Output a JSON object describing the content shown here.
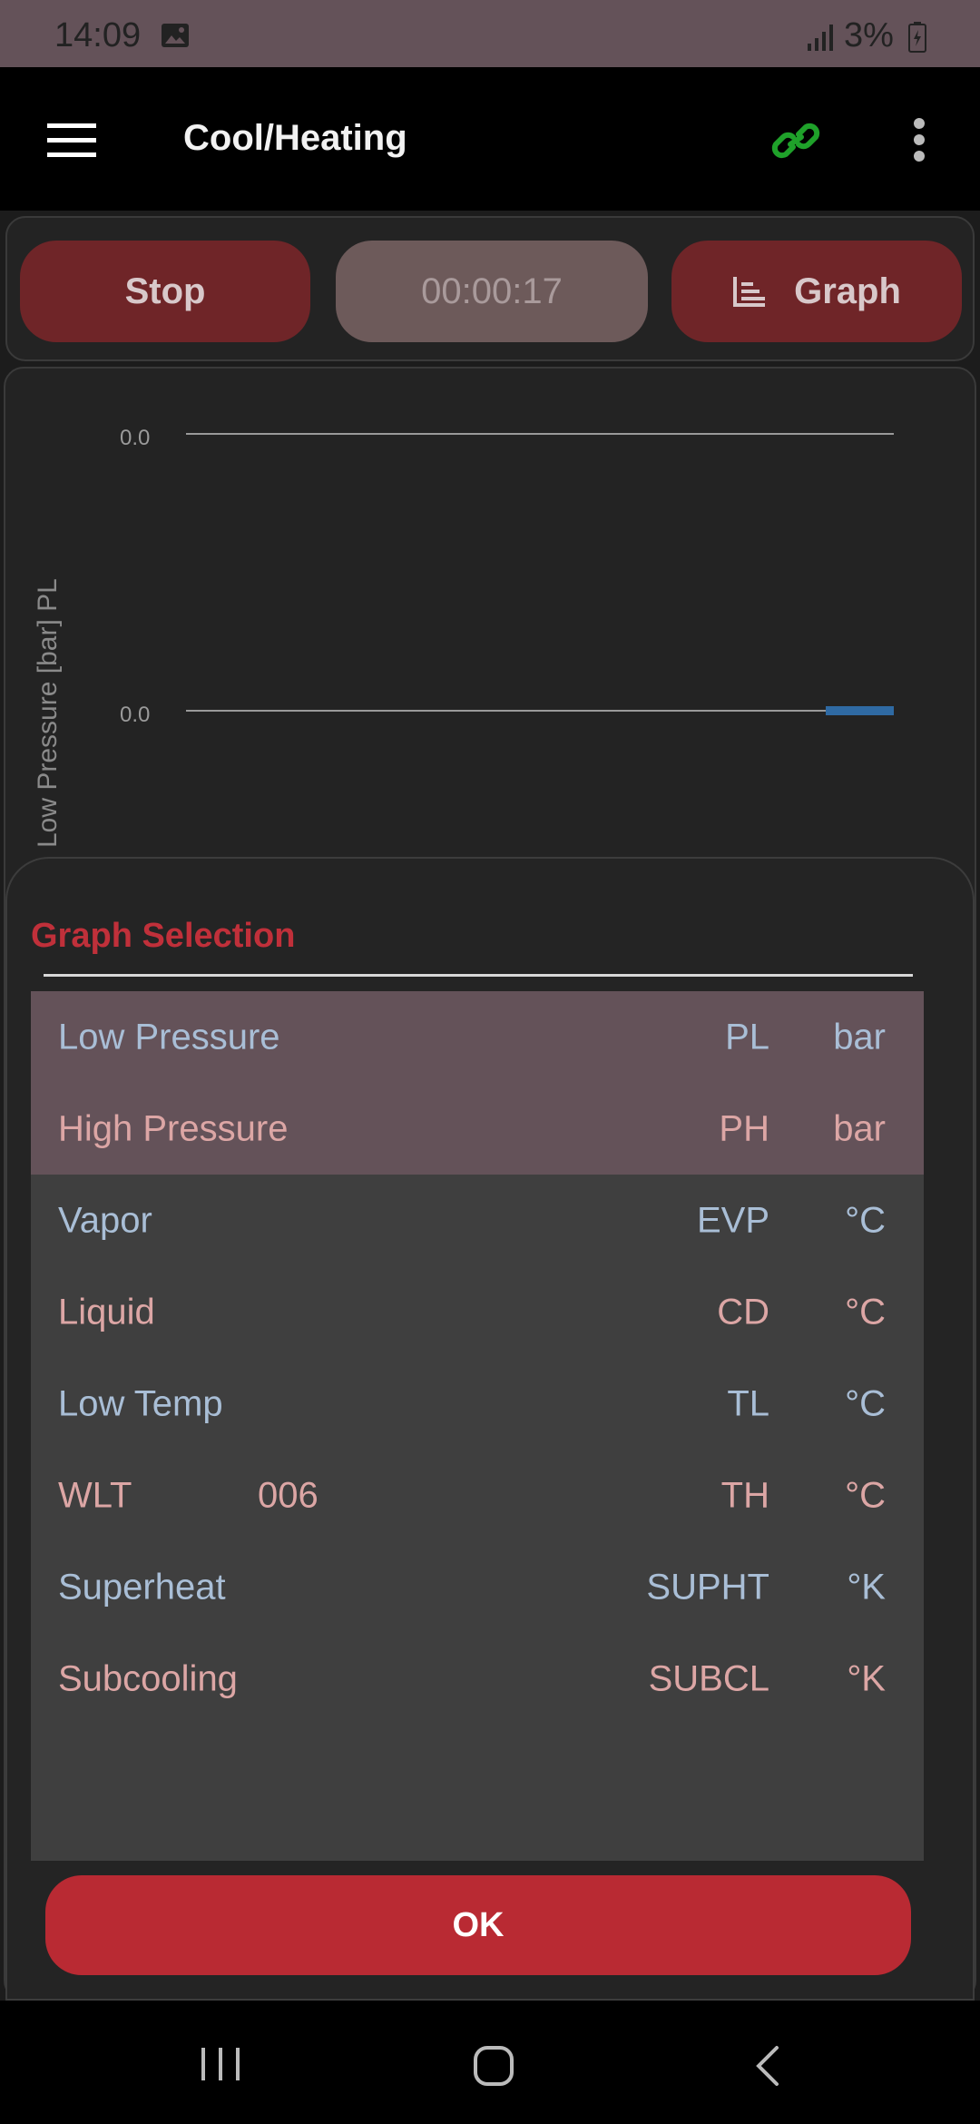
{
  "status_bar": {
    "time": "14:09",
    "battery": "3%"
  },
  "toolbar": {
    "title": "Cool/Heating",
    "menu_icon": "hamburger-menu-icon",
    "link_icon": "link-icon",
    "link_color": "#1fa12a",
    "more_icon": "more-vert-icon"
  },
  "controls": {
    "stop_label": "Stop",
    "timer": "00:00:17",
    "graph_label": "Graph",
    "graph_icon": "bar-chart-icon"
  },
  "chart_data": {
    "type": "line",
    "ylabel": "Low Pressure [bar] PL",
    "y_tick_labels": [
      "0.0",
      "0.0"
    ],
    "series": [
      {
        "values": [
          0.0
        ],
        "color": "#2f6aa3"
      }
    ],
    "grid": true
  },
  "sheet": {
    "title": "Graph Selection",
    "rows": [
      {
        "name": "Low Pressure",
        "extra": "",
        "code": "PL",
        "unit": "bar",
        "selected": true,
        "tone": "blue"
      },
      {
        "name": "High Pressure",
        "extra": "",
        "code": "PH",
        "unit": "bar",
        "selected": true,
        "tone": "pink"
      },
      {
        "name": "Vapor",
        "extra": "",
        "code": "EVP",
        "unit": "°C",
        "selected": false,
        "tone": "blue"
      },
      {
        "name": "Liquid",
        "extra": "",
        "code": "CD",
        "unit": "°C",
        "selected": false,
        "tone": "pink"
      },
      {
        "name": "Low Temp",
        "extra": "",
        "code": "TL",
        "unit": "°C",
        "selected": false,
        "tone": "blue"
      },
      {
        "name": "WLT",
        "extra": "006",
        "code": "TH",
        "unit": "°C",
        "selected": false,
        "tone": "pink"
      },
      {
        "name": "Superheat",
        "extra": "",
        "code": "SUPHT",
        "unit": "°K",
        "selected": false,
        "tone": "blue"
      },
      {
        "name": "Subcooling",
        "extra": "",
        "code": "SUBCL",
        "unit": "°K",
        "selected": false,
        "tone": "pink"
      }
    ],
    "ok_label": "OK"
  },
  "colors": {
    "accent_red": "#b92a33",
    "selected_row": "#645259",
    "list_bg": "#3f3f3f"
  },
  "nav_bar": {
    "recents_icon": "recents-icon",
    "home_icon": "home-icon",
    "back_icon": "back-icon"
  }
}
